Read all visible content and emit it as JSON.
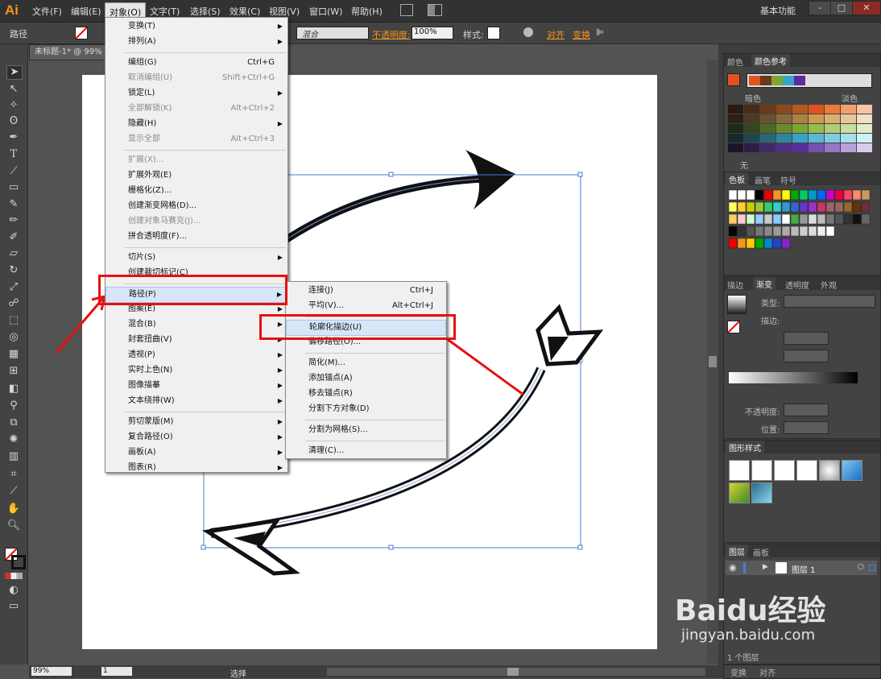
{
  "app": {
    "logo": "Ai",
    "workspace": "基本功能",
    "minimize": "-",
    "maximize": "□",
    "close": "✕"
  },
  "menubar": {
    "items": [
      "文件(F)",
      "编辑(E)",
      "对象(O)",
      "文字(T)",
      "选择(S)",
      "效果(C)",
      "视图(V)",
      "窗口(W)",
      "帮助(H)"
    ],
    "active": "对象(O)"
  },
  "control": {
    "selection_label": "路径",
    "blend_mode": "混合",
    "opacity_label": "不透明度:",
    "opacity_value": "100%",
    "style_label": "样式:",
    "align_link": "对齐",
    "transform_link": "变换"
  },
  "document": {
    "tab_title": "未标题-1* @ 99%",
    "zoom": "99%",
    "page": "1",
    "status": "选择"
  },
  "object_menu": [
    {
      "label": "变换(T)",
      "arrow": true
    },
    {
      "label": "排列(A)",
      "arrow": true
    },
    {
      "sep": true
    },
    {
      "label": "编组(G)",
      "shortcut": "Ctrl+G"
    },
    {
      "label": "取消编组(U)",
      "shortcut": "Shift+Ctrl+G",
      "disabled": true
    },
    {
      "label": "锁定(L)",
      "arrow": true
    },
    {
      "label": "全部解锁(K)",
      "shortcut": "Alt+Ctrl+2",
      "disabled": true
    },
    {
      "label": "隐藏(H)",
      "arrow": true
    },
    {
      "label": "显示全部",
      "shortcut": "Alt+Ctrl+3",
      "disabled": true
    },
    {
      "sep": true
    },
    {
      "label": "扩展(X)...",
      "disabled": true
    },
    {
      "label": "扩展外观(E)"
    },
    {
      "label": "栅格化(Z)..."
    },
    {
      "label": "创建渐变网格(D)..."
    },
    {
      "label": "创建对象马赛克(J)...",
      "disabled": true
    },
    {
      "label": "拼合透明度(F)..."
    },
    {
      "sep": true
    },
    {
      "label": "切片(S)",
      "arrow": true
    },
    {
      "label": "创建裁切标记(C)"
    },
    {
      "sep": true
    },
    {
      "label": "路径(P)",
      "arrow": true,
      "highlight": true
    },
    {
      "label": "图案(E)",
      "arrow": true
    },
    {
      "label": "混合(B)",
      "arrow": true
    },
    {
      "label": "封套扭曲(V)",
      "arrow": true
    },
    {
      "label": "透视(P)",
      "arrow": true
    },
    {
      "label": "实时上色(N)",
      "arrow": true
    },
    {
      "label": "图像描摹",
      "arrow": true
    },
    {
      "label": "文本绕排(W)",
      "arrow": true
    },
    {
      "sep": true
    },
    {
      "label": "剪切蒙版(M)",
      "arrow": true
    },
    {
      "label": "复合路径(O)",
      "arrow": true
    },
    {
      "label": "画板(A)",
      "arrow": true
    },
    {
      "label": "图表(R)",
      "arrow": true
    }
  ],
  "path_submenu": [
    {
      "label": "连接(J)",
      "shortcut": "Ctrl+J"
    },
    {
      "label": "平均(V)...",
      "shortcut": "Alt+Ctrl+J"
    },
    {
      "sep": true
    },
    {
      "label": "轮廓化描边(U)",
      "highlight": true
    },
    {
      "label": "偏移路径(O)..."
    },
    {
      "sep": true
    },
    {
      "label": "简化(M)..."
    },
    {
      "label": "添加锚点(A)"
    },
    {
      "label": "移去锚点(R)"
    },
    {
      "label": "分割下方对象(D)"
    },
    {
      "sep": true
    },
    {
      "label": "分割为网格(S)..."
    },
    {
      "sep": true
    },
    {
      "label": "清理(C)..."
    }
  ],
  "panels": {
    "color": {
      "tabs": [
        "颜色",
        "颜色参考"
      ],
      "dark_label": "暗色",
      "light_label": "淡色",
      "none_label": "无"
    },
    "swatches": {
      "tabs": [
        "色板",
        "画笔",
        "符号"
      ]
    },
    "gradient": {
      "tabs": [
        "描边",
        "渐变",
        "透明度",
        "外观"
      ],
      "type_label": "类型:",
      "stroke_label": "描边:",
      "opacity_label": "不透明度:",
      "position_label": "位置:"
    },
    "graphic_styles": {
      "tabs": [
        "图形样式"
      ]
    },
    "layers": {
      "tabs": [
        "图层",
        "画板"
      ],
      "layer_name": "图层 1",
      "count": "1 个图层"
    },
    "bottom": {
      "tabs": [
        "变换",
        "对齐"
      ]
    }
  },
  "watermark": {
    "brand": "Baidu经验",
    "url": "jingyan.baidu.com"
  },
  "colors": {
    "accent_orange": "#f7941d",
    "highlight_red": "#e81010",
    "selection_blue": "#4a7bd6"
  }
}
